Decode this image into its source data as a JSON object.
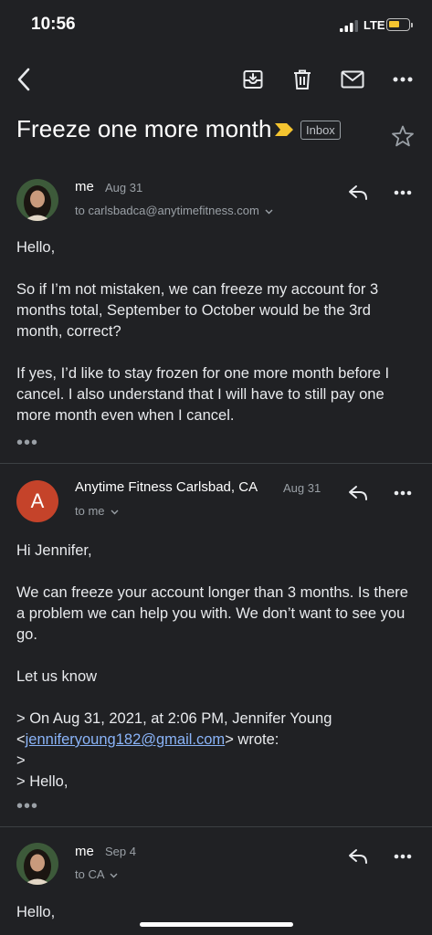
{
  "status_bar": {
    "time": "10:56",
    "network": "LTE",
    "battery_color": "#f4c430"
  },
  "toolbar": {
    "back_icon": "chevron-left-icon",
    "archive_icon": "archive-icon",
    "delete_icon": "trash-icon",
    "mail_icon": "mail-icon",
    "more_icon": "more-horizontal-icon"
  },
  "thread": {
    "subject": "Freeze one more month",
    "label": "Inbox",
    "importance_color": "#f4c430"
  },
  "messages": [
    {
      "sender": "me",
      "date": "Aug 31",
      "recipients": "to carlsbadca@anytimefitness.com",
      "body": [
        "Hello,",
        "So if I’m not mistaken, we can freeze my account for 3 months total, September to October would be the 3rd month, correct?",
        "If yes, I’d like to stay frozen for one more month before I cancel. I also understand that I will have to still pay one more month even when I cancel."
      ],
      "more": "•••"
    },
    {
      "sender": "Anytime Fitness Carlsbad, CA",
      "avatar_letter": "A",
      "avatar_color": "#c5432a",
      "date": "Aug 31",
      "recipients": "to me",
      "body": [
        "Hi Jennifer,",
        "We can freeze your account longer than 3 months. Is there a problem we can help you with. We don’t want to see you go.",
        "Let us know",
        "> On Aug 31, 2021, at 2:06 PM, Jennifer Young",
        "<",
        "jenniferyoung182@gmail.com",
        "> wrote:",
        ">",
        "> Hello,"
      ],
      "more": "•••"
    },
    {
      "sender": "me",
      "date": "Sep 4",
      "recipients": "to CA",
      "body": [
        "Hello,"
      ]
    }
  ]
}
